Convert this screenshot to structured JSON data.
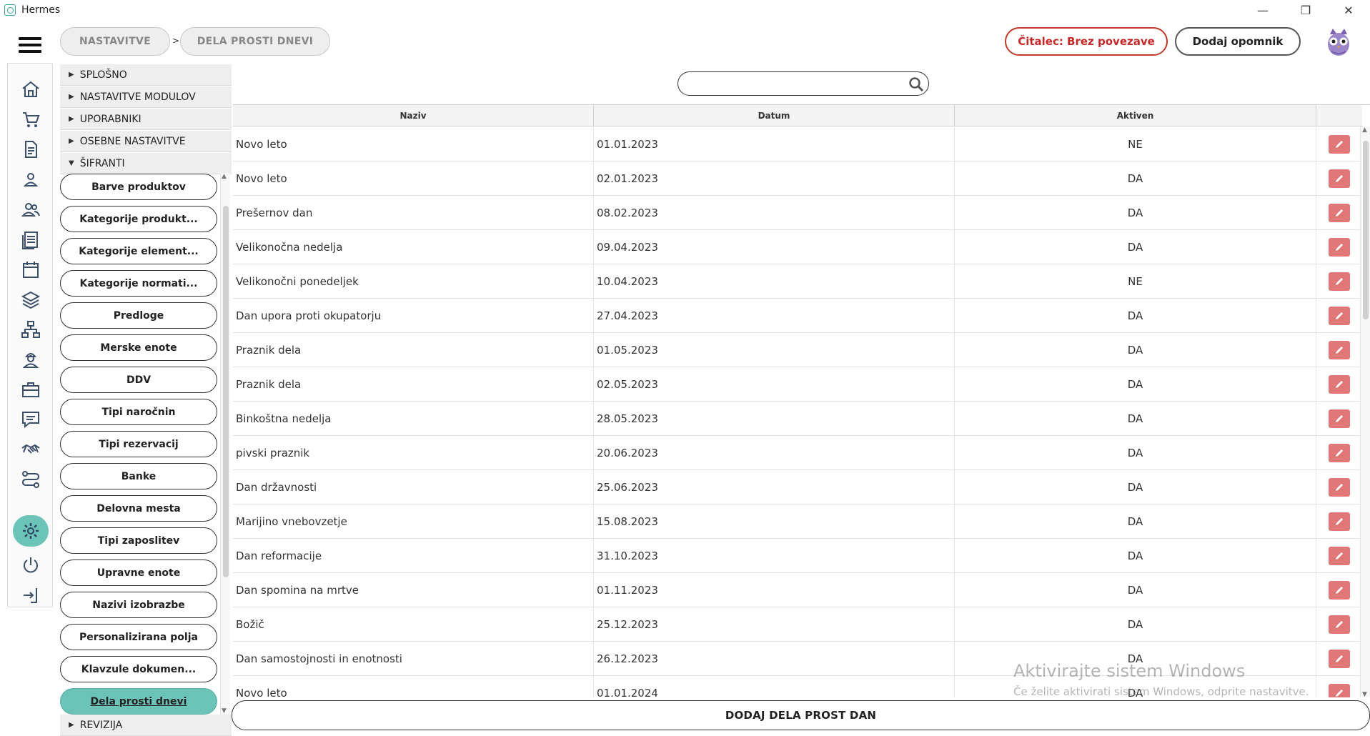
{
  "window": {
    "title": "Hermes",
    "controls": {
      "minimize": "—",
      "restore": "❐",
      "close": "✕"
    }
  },
  "breadcrumb": [
    "NASTAVITVE",
    "DELA PROSTI DNEVI"
  ],
  "breadcrumb_separator": ">",
  "header": {
    "reader_label": "Čitalec: Brez povezave",
    "reminder_label": "Dodaj opomnik"
  },
  "colors": {
    "accent": "#6cc4b8",
    "reader_red": "#c62828",
    "edit_button": "#e07878"
  },
  "sidebar_icons": [
    "home-icon",
    "cart-icon",
    "document-icon",
    "user-icon",
    "users-icon",
    "list-icon",
    "calendar-icon",
    "layers-icon",
    "network-icon",
    "worker-icon",
    "briefcase-icon",
    "chat-icon",
    "handshake-icon",
    "route-icon",
    "gear-icon",
    "power-icon",
    "logout-icon"
  ],
  "sections": [
    {
      "label": "SPLOŠNO",
      "expanded": false
    },
    {
      "label": "NASTAVITVE MODULOV",
      "expanded": false
    },
    {
      "label": "UPORABNIKI",
      "expanded": false
    },
    {
      "label": "OSEBNE NASTAVITVE",
      "expanded": false
    },
    {
      "label": "ŠIFRANTI",
      "expanded": true
    },
    {
      "label": "REVIZIJA",
      "expanded": false
    }
  ],
  "sifranti_items": [
    "Barve produktov",
    "Kategorije produkt...",
    "Kategorije element...",
    "Kategorije normati...",
    "Predloge",
    "Merske enote",
    "DDV",
    "Tipi naročnin",
    "Tipi rezervacij",
    "Banke",
    "Delovna mesta",
    "Tipi zaposlitev",
    "Upravne enote",
    "Nazivi izobrazbe",
    "Personalizirana polja",
    "Klavzule dokumen...",
    "Dela prosti dnevi"
  ],
  "active_item": "Dela prosti dnevi",
  "search": {
    "value": "",
    "placeholder": ""
  },
  "table": {
    "headers": [
      "Naziv",
      "Datum",
      "Aktiven",
      ""
    ],
    "rows": [
      [
        "Novo leto",
        "01.01.2023",
        "NE"
      ],
      [
        "Novo leto",
        "02.01.2023",
        "DA"
      ],
      [
        "Prešernov dan",
        "08.02.2023",
        "DA"
      ],
      [
        "Velikonočna nedelja",
        "09.04.2023",
        "DA"
      ],
      [
        "Velikonočni ponedeljek",
        "10.04.2023",
        "NE"
      ],
      [
        "Dan upora proti okupatorju",
        "27.04.2023",
        "DA"
      ],
      [
        "Praznik dela",
        "01.05.2023",
        "DA"
      ],
      [
        "Praznik dela",
        "02.05.2023",
        "DA"
      ],
      [
        "Binkoštna nedelja",
        "28.05.2023",
        "DA"
      ],
      [
        "pivski praznik",
        "20.06.2023",
        "DA"
      ],
      [
        "Dan državnosti",
        "25.06.2023",
        "DA"
      ],
      [
        "Marijino vnebovzetje",
        "15.08.2023",
        "DA"
      ],
      [
        "Dan reformacije",
        "31.10.2023",
        "DA"
      ],
      [
        "Dan spomina na mrtve",
        "01.11.2023",
        "DA"
      ],
      [
        "Božič",
        "25.12.2023",
        "DA"
      ],
      [
        "Dan samostojnosti in enotnosti",
        "26.12.2023",
        "DA"
      ],
      [
        "Novo leto",
        "01.01.2024",
        "DA"
      ]
    ]
  },
  "add_button_label": "DODAJ DELA PROST DAN",
  "watermark": {
    "line1": "Aktivirajte sistem Windows",
    "line2": "Če želite aktivirati sistem Windows, odprite nastavitve."
  }
}
